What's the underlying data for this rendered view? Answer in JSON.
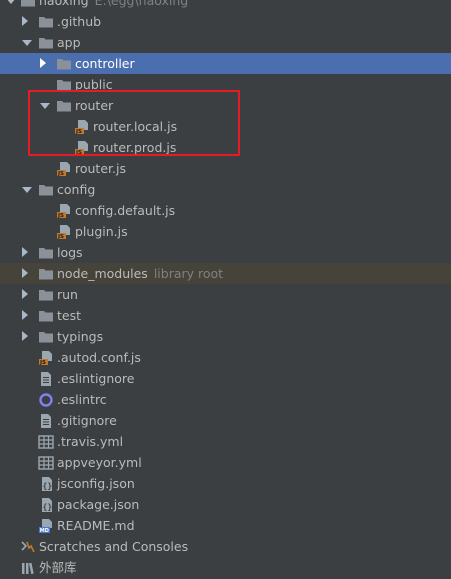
{
  "project": {
    "name": "haoxing",
    "path": "E:\\egg\\haoxing"
  },
  "tree": [
    {
      "label": "haoxing",
      "hint": "E:\\egg\\haoxing",
      "depth": 0,
      "icon": "folder-icon",
      "arrow": "down",
      "partial": true
    },
    {
      "label": ".github",
      "depth": 1,
      "icon": "folder-icon",
      "arrow": "right"
    },
    {
      "label": "app",
      "depth": 1,
      "icon": "folder-icon",
      "arrow": "down"
    },
    {
      "label": "controller",
      "depth": 2,
      "icon": "folder-icon",
      "arrow": "right",
      "selected": true
    },
    {
      "label": "public",
      "depth": 2,
      "icon": "folder-icon",
      "arrow": "none"
    },
    {
      "label": "router",
      "depth": 2,
      "icon": "folder-icon",
      "arrow": "down"
    },
    {
      "label": "router.local.js",
      "depth": 3,
      "icon": "js-file-icon"
    },
    {
      "label": "router.prod.js",
      "depth": 3,
      "icon": "js-file-icon"
    },
    {
      "label": "router.js",
      "depth": 2,
      "icon": "js-file-icon"
    },
    {
      "label": "config",
      "depth": 1,
      "icon": "folder-icon",
      "arrow": "down"
    },
    {
      "label": "config.default.js",
      "depth": 2,
      "icon": "js-file-icon"
    },
    {
      "label": "plugin.js",
      "depth": 2,
      "icon": "js-file-icon"
    },
    {
      "label": "logs",
      "depth": 1,
      "icon": "folder-icon",
      "arrow": "right"
    },
    {
      "label": "node_modules",
      "hint": "library root",
      "depth": 1,
      "icon": "folder-icon",
      "arrow": "right",
      "excluded": true
    },
    {
      "label": "run",
      "depth": 1,
      "icon": "folder-icon",
      "arrow": "right"
    },
    {
      "label": "test",
      "depth": 1,
      "icon": "folder-icon",
      "arrow": "right"
    },
    {
      "label": "typings",
      "depth": 1,
      "icon": "folder-icon",
      "arrow": "right"
    },
    {
      "label": ".autod.conf.js",
      "depth": 1,
      "icon": "js-file-icon"
    },
    {
      "label": ".eslintignore",
      "depth": 1,
      "icon": "text-file-icon"
    },
    {
      "label": ".eslintrc",
      "depth": 1,
      "icon": "eslint-icon"
    },
    {
      "label": ".gitignore",
      "depth": 1,
      "icon": "text-file-icon"
    },
    {
      "label": ".travis.yml",
      "depth": 1,
      "icon": "yaml-file-icon"
    },
    {
      "label": "appveyor.yml",
      "depth": 1,
      "icon": "yaml-file-icon"
    },
    {
      "label": "jsconfig.json",
      "depth": 1,
      "icon": "json-file-icon"
    },
    {
      "label": "package.json",
      "depth": 1,
      "icon": "json-file-icon"
    },
    {
      "label": "README.md",
      "depth": 1,
      "icon": "markdown-file-icon"
    },
    {
      "label": "Scratches and Consoles",
      "depth": 0,
      "icon": "scratches-icon"
    },
    {
      "label": "外部库",
      "depth": 0,
      "icon": "library-icon"
    }
  ],
  "colors": {
    "background": "#3c3f41",
    "selection": "#4b6eaf",
    "excluded": "#45433a",
    "folder": "#8a9199",
    "highlight_box": "#e51c23",
    "js_badge": "#c07a2e"
  }
}
